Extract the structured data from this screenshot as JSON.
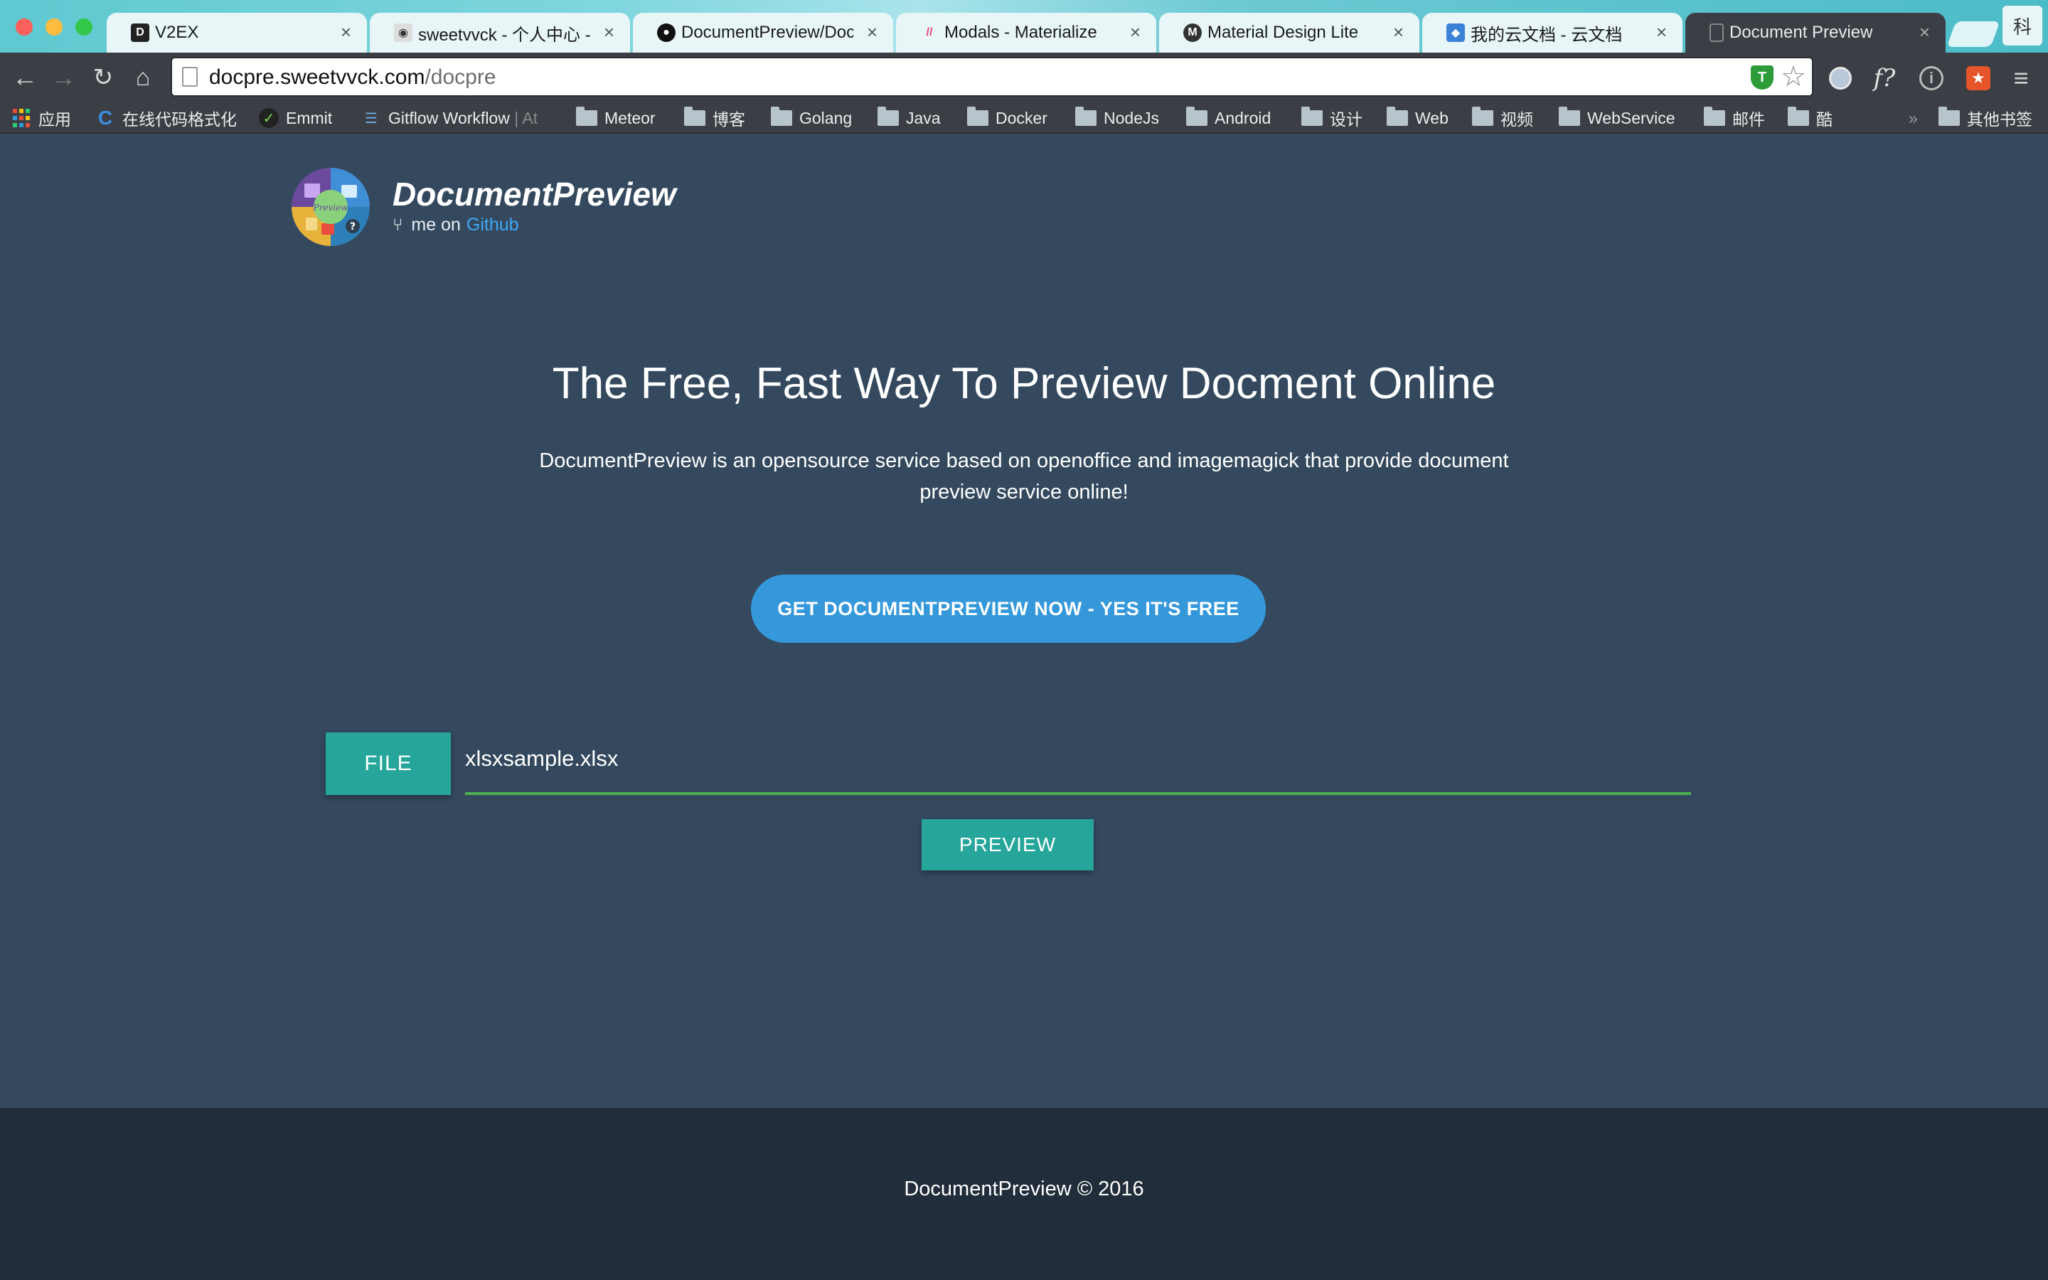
{
  "browser": {
    "tabs": [
      {
        "title": "V2EX",
        "icon": "v2ex-icon",
        "active": false
      },
      {
        "title": "sweetvvck - 个人中心 - C",
        "icon": "oschina-icon",
        "active": false
      },
      {
        "title": "DocumentPreview/Docu",
        "icon": "github-icon",
        "active": false
      },
      {
        "title": "Modals - Materialize",
        "icon": "materialize-icon",
        "active": false
      },
      {
        "title": "Material Design Lite",
        "icon": "mdl-icon",
        "active": false
      },
      {
        "title": "我的云文档 - 云文档",
        "icon": "cloud-doc-icon",
        "active": false
      },
      {
        "title": "Document Preview",
        "icon": "page-icon",
        "active": true
      }
    ],
    "tab_close_glyph": "×",
    "profile_label": "科",
    "url": {
      "host": "docpre.sweetvvck.com",
      "path": "/docpre"
    },
    "shield_label": "T",
    "bookmarks": [
      {
        "label": "应用",
        "icon": "apps-grid-icon"
      },
      {
        "label": "在线代码格式化",
        "icon": "c-logo-icon"
      },
      {
        "label": "Emmit",
        "icon": "emmet-icon"
      },
      {
        "label": "Gitflow Workflow",
        "suffix": "| At",
        "icon": "database-icon"
      },
      {
        "label": "Meteor",
        "icon": "folder-icon"
      },
      {
        "label": "博客",
        "icon": "folder-icon"
      },
      {
        "label": "Golang",
        "icon": "folder-icon"
      },
      {
        "label": "Java",
        "icon": "folder-icon"
      },
      {
        "label": "Docker",
        "icon": "folder-icon"
      },
      {
        "label": "NodeJs",
        "icon": "folder-icon"
      },
      {
        "label": "Android",
        "icon": "folder-icon"
      },
      {
        "label": "设计",
        "icon": "folder-icon"
      },
      {
        "label": "Web",
        "icon": "folder-icon"
      },
      {
        "label": "视频",
        "icon": "folder-icon"
      },
      {
        "label": "WebService",
        "icon": "folder-icon"
      },
      {
        "label": "邮件",
        "icon": "folder-icon"
      },
      {
        "label": "酷",
        "icon": "folder-icon"
      }
    ],
    "bookmarks_overflow": "»",
    "other_bookmarks": "其他书签"
  },
  "page": {
    "brand": {
      "name": "DocumentPreview",
      "sub_prefix": "me on",
      "sub_link": "Github",
      "logo_text": "Preview"
    },
    "headline": "The Free, Fast Way To Preview Docment Online",
    "description": "DocumentPreview is an opensource service based on openoffice and imagemagick that provide document preview service online!",
    "cta_label": "GET DOCUMENTPREVIEW NOW - YES IT'S FREE",
    "file_button": "FILE",
    "file_name": "xlsxsample.xlsx",
    "preview_button": "PREVIEW",
    "footer": "DocumentPreview © 2016"
  },
  "colors": {
    "background": "#34495e",
    "footer": "#212d3a",
    "cta": "#3498db",
    "teal_button": "#26a69a",
    "input_underline": "#4caf50",
    "link": "#3fa9f5"
  }
}
